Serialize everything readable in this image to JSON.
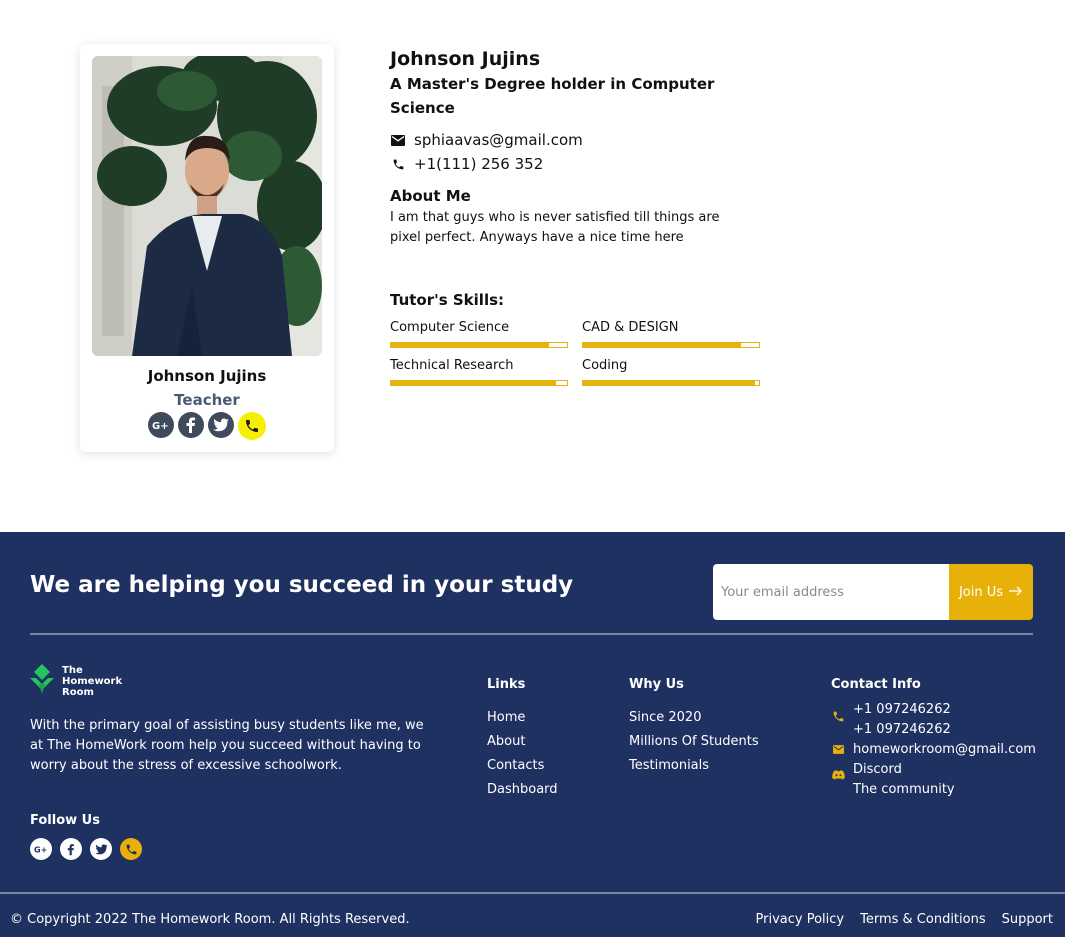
{
  "profile_card": {
    "name": "Johnson Jujins",
    "role": "Teacher",
    "social": [
      "google-plus-icon",
      "facebook-icon",
      "twitter-icon",
      "phone-icon"
    ]
  },
  "profile": {
    "name": "Johnson Jujins",
    "degree": "A Master's Degree holder in Computer Science",
    "email": "sphiaavas@gmail.com",
    "phone": "+1(111) 256 352",
    "about_heading": "About Me",
    "about_text": "I am that guys who is never satisfied till things are pixel perfect. Anyways have a nice time here",
    "skills_heading": "Tutor's Skills:",
    "skills": [
      {
        "label": "Computer Science",
        "level": 0.9
      },
      {
        "label": "CAD & DESIGN",
        "level": 0.9
      },
      {
        "label": "Technical Research",
        "level": 0.94
      },
      {
        "label": "Coding",
        "level": 0.98
      }
    ]
  },
  "footer": {
    "headline": "We are helping you succeed in your study",
    "subscribe": {
      "placeholder": "Your email address",
      "button_label": "Join Us",
      "button_icon": "arrow-right-icon"
    },
    "brand": {
      "line1": "The",
      "line2": "Homework",
      "line3": "Room",
      "description": "With the primary goal of assisting busy students like me, we at The HomeWork room help you succeed without having to worry about the stress of excessive schoolwork."
    },
    "follow_heading": "Follow Us",
    "follow_icons": [
      "google-plus-icon",
      "facebook-icon",
      "twitter-icon",
      "phone-icon"
    ],
    "links": {
      "heading": "Links",
      "items": [
        "Home",
        "About",
        "Contacts",
        "Dashboard"
      ]
    },
    "why_us": {
      "heading": "Why Us",
      "items": [
        "Since 2020",
        "Millions Of Students",
        "Testimonials"
      ]
    },
    "contact_info": {
      "heading": "Contact Info",
      "phone1": "+1 097246262",
      "phone2": "+1 097246262",
      "email": "homeworkroom@gmail.com",
      "discord": "Discord",
      "community": "The community"
    },
    "copyright": "© Copyright 2022 The Homework Room. All Rights Reserved.",
    "legal": [
      "Privacy Policy",
      "Terms & Conditions",
      "Support"
    ]
  },
  "colors": {
    "footer_bg": "#1f3161",
    "accent": "#e4b30d",
    "phone_highlight": "#f5f000"
  }
}
